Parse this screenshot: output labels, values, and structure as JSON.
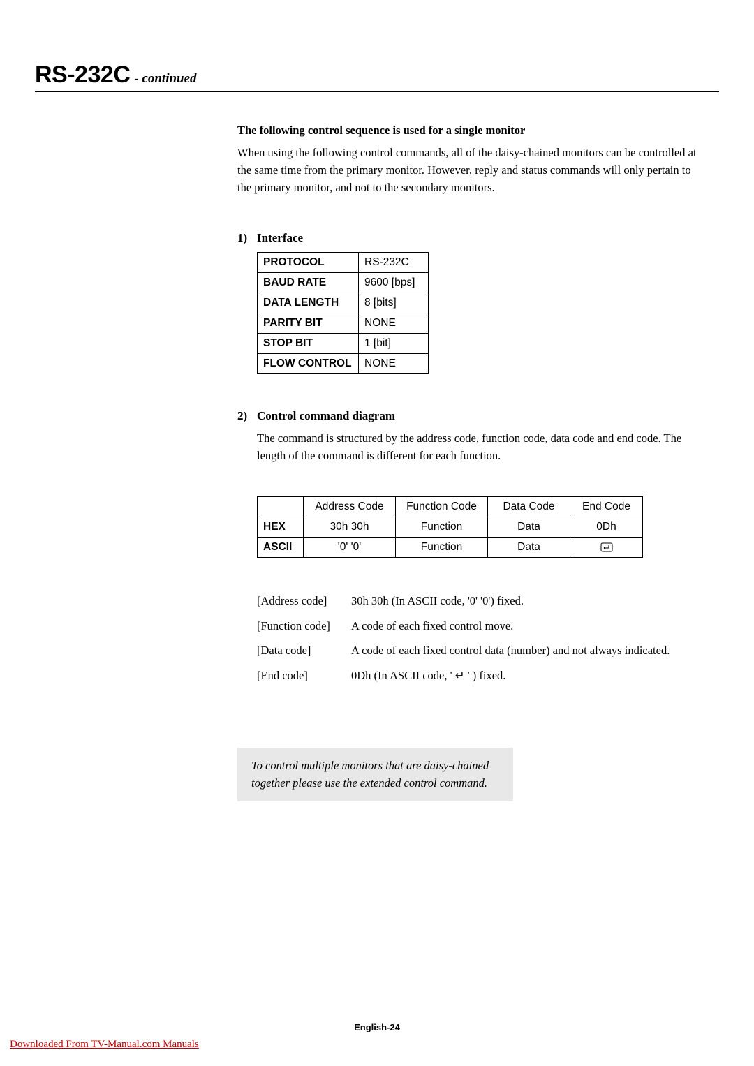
{
  "header": {
    "title": "RS-232C",
    "subtitle": "- continued"
  },
  "intro": {
    "heading": "The following control sequence is used for a single monitor",
    "paragraph": "When using the following control commands, all of the daisy-chained monitors can be controlled at the same time from the primary monitor. However, reply and status commands will only pertain to the primary monitor, and not to the secondary monitors."
  },
  "section1": {
    "number": "1)",
    "title": "Interface",
    "table": [
      {
        "label": "PROTOCOL",
        "value": "RS-232C"
      },
      {
        "label": "BAUD RATE",
        "value": "9600 [bps]"
      },
      {
        "label": "DATA LENGTH",
        "value": "8 [bits]"
      },
      {
        "label": "PARITY BIT",
        "value": "NONE"
      },
      {
        "label": "STOP BIT",
        "value": "1 [bit]"
      },
      {
        "label": "FLOW CONTROL",
        "value": "NONE"
      }
    ]
  },
  "section2": {
    "number": "2)",
    "title": "Control command diagram",
    "description": "The command is structured by the address code, function code, data code and end code. The length of the command is different for each function.",
    "table": {
      "headers": [
        "",
        "Address Code",
        "Function Code",
        "Data Code",
        "End Code"
      ],
      "rows": [
        {
          "label": "HEX",
          "cells": [
            "30h 30h",
            "Function",
            "Data",
            "0Dh"
          ]
        },
        {
          "label": "ASCII",
          "cells": [
            "'0' '0'",
            "Function",
            "Data",
            "↵"
          ]
        }
      ]
    },
    "definitions": [
      {
        "label": "[Address code]",
        "value": "30h 30h (In ASCII code, '0' '0') fixed."
      },
      {
        "label": "[Function code]",
        "value": "A code of each fixed control move."
      },
      {
        "label": "[Data code]",
        "value": "A code of each fixed control data (number) and not always indicated."
      },
      {
        "label": "[End code]",
        "value": "0Dh (In ASCII code, ' ↵ ' ) fixed."
      }
    ]
  },
  "note": "To control multiple monitors that are daisy-chained together please use the extended control command.",
  "footer": {
    "page": "English-24",
    "download": "Downloaded From TV-Manual.com Manuals"
  }
}
